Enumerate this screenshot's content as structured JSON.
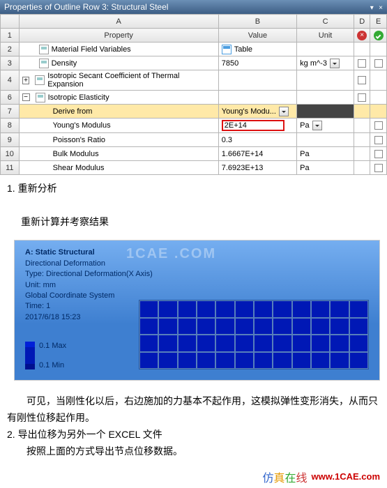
{
  "titlebar": {
    "title": "Properties of Outline Row 3: Structural Steel",
    "btn_up": "▾",
    "btn_close": "×"
  },
  "columns": {
    "A": "A",
    "B": "B",
    "C": "C",
    "D": "D",
    "E": "E"
  },
  "header": {
    "property": "Property",
    "value": "Value",
    "unit": "Unit"
  },
  "rows": {
    "r1": "1",
    "r2": {
      "n": "2",
      "label": "Material Field Variables",
      "value": "Table"
    },
    "r3": {
      "n": "3",
      "label": "Density",
      "value": "7850",
      "unit": "kg m^-3"
    },
    "r4": {
      "n": "4",
      "label": "Isotropic Secant Coefficient of Thermal Expansion"
    },
    "r6": {
      "n": "6",
      "label": "Isotropic Elasticity"
    },
    "r7": {
      "n": "7",
      "label": "Derive from",
      "value": "Young's Modu..."
    },
    "r8": {
      "n": "8",
      "label": "Young's Modulus",
      "value": "2E+14",
      "unit": "Pa"
    },
    "r9": {
      "n": "9",
      "label": "Poisson's Ratio",
      "value": "0.3"
    },
    "r10": {
      "n": "10",
      "label": "Bulk Modulus",
      "value": "1.6667E+14",
      "unit": "Pa"
    },
    "r11": {
      "n": "11",
      "label": "Shear Modulus",
      "value": "7.6923E+13",
      "unit": "Pa"
    },
    "plus": "+",
    "minus": "−"
  },
  "doc": {
    "step1": "1. 重新分析",
    "step1b": "重新计算并考察结果",
    "para1": "　　可见，当刚性化以后，右边施加的力基本不起作用，这模拟弹性变形消失，从而只有刚性位移起作用。",
    "step2": "2. 导出位移为另外一个 EXCEL 文件",
    "step2b": "　　按照上面的方式导出节点位移数据。"
  },
  "viewer": {
    "title": "A: Static Structural",
    "l2": "Directional Deformation",
    "l3": "Type: Directional Deformation(X Axis)",
    "l4": "Unit: mm",
    "l5": "Global Coordinate System",
    "l6": "Time: 1",
    "l7": "2017/6/18 15:23",
    "max": "0.1 Max",
    "min": "0.1 Min",
    "wm": "1CAE .COM"
  },
  "footer": {
    "brand1": "仿",
    "brand2": "真",
    "brand3": "在",
    "brand4": "线",
    "url": "www.1CAE.com"
  }
}
